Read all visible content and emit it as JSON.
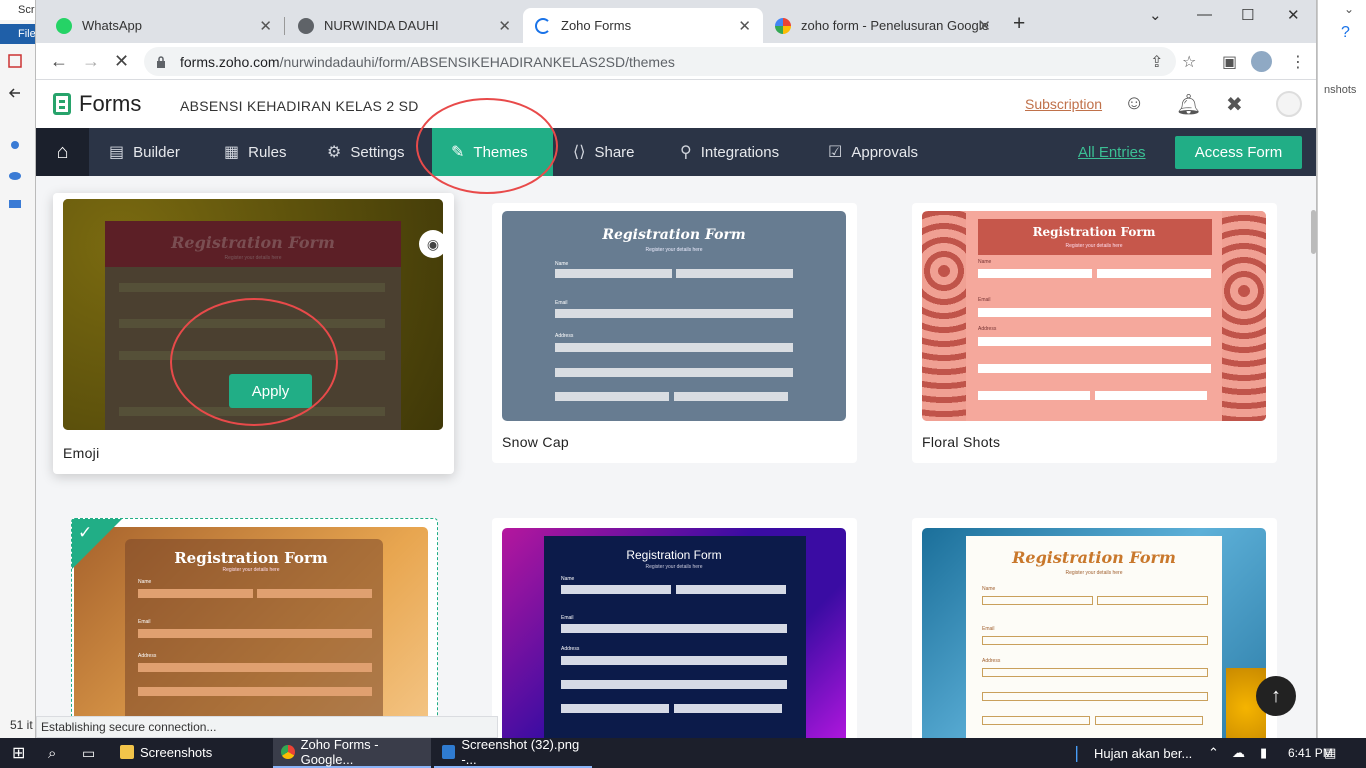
{
  "desktop": {
    "left_top_label": "Scr",
    "left_file_label": "File",
    "right_snippet": "nshots",
    "bottom_left_count": "51 it"
  },
  "browser": {
    "tabs": [
      {
        "title": "WhatsApp",
        "icon": "whatsapp-icon",
        "color": "#25d366"
      },
      {
        "title": "NURWINDA DAUHI",
        "icon": "globe-icon",
        "color": "#5f6368"
      },
      {
        "title": "Zoho Forms",
        "icon": "loading-icon",
        "color": "#1a73e8",
        "active": true
      },
      {
        "title": "zoho form - Penelusuran Google",
        "icon": "google-icon",
        "color": "#4285f4"
      }
    ],
    "url_host": "forms.zoho.com",
    "url_path": "/nurwindadauhi/form/ABSENSIKEHADIRANKELAS2SD/themes",
    "status_text": "Establishing secure connection..."
  },
  "app": {
    "brand": "Forms",
    "form_name": "ABSENSI KEHADIRAN KELAS 2 SD",
    "subscription": "Subscription",
    "nav": [
      {
        "label": "Builder",
        "icon": "builder-icon"
      },
      {
        "label": "Rules",
        "icon": "rules-icon"
      },
      {
        "label": "Settings",
        "icon": "gear-icon"
      },
      {
        "label": "Themes",
        "icon": "brush-icon",
        "active": true
      },
      {
        "label": "Share",
        "icon": "share-icon"
      },
      {
        "label": "Integrations",
        "icon": "integrations-icon"
      },
      {
        "label": "Approvals",
        "icon": "approvals-icon"
      }
    ],
    "all_entries": "All Entries",
    "access_form": "Access Form",
    "accent": "#21ae86"
  },
  "themes": {
    "apply_label": "Apply",
    "cards": [
      {
        "name": "Emoji"
      },
      {
        "name": "Snow Cap"
      },
      {
        "name": "Floral Shots"
      }
    ],
    "preview": {
      "title": "Registration Form",
      "subtitle": "Register your details here",
      "name_label": "Name",
      "first_label": "First",
      "last_label": "Last",
      "email_label": "Email",
      "address_label": "Address",
      "street_label": "Street Address",
      "address2_label": "Address Line 2",
      "city_label": "City",
      "state_label": "State/Region/Province"
    }
  },
  "taskbar": {
    "items": [
      {
        "label": "Screenshots",
        "icon": "folder-icon"
      },
      {
        "label": "Zoho Forms - Google...",
        "icon": "chrome-icon"
      },
      {
        "label": "Screenshot (32).png -...",
        "icon": "image-icon"
      }
    ],
    "weather": "Hujan akan ber...",
    "time": "6:41 PM"
  }
}
